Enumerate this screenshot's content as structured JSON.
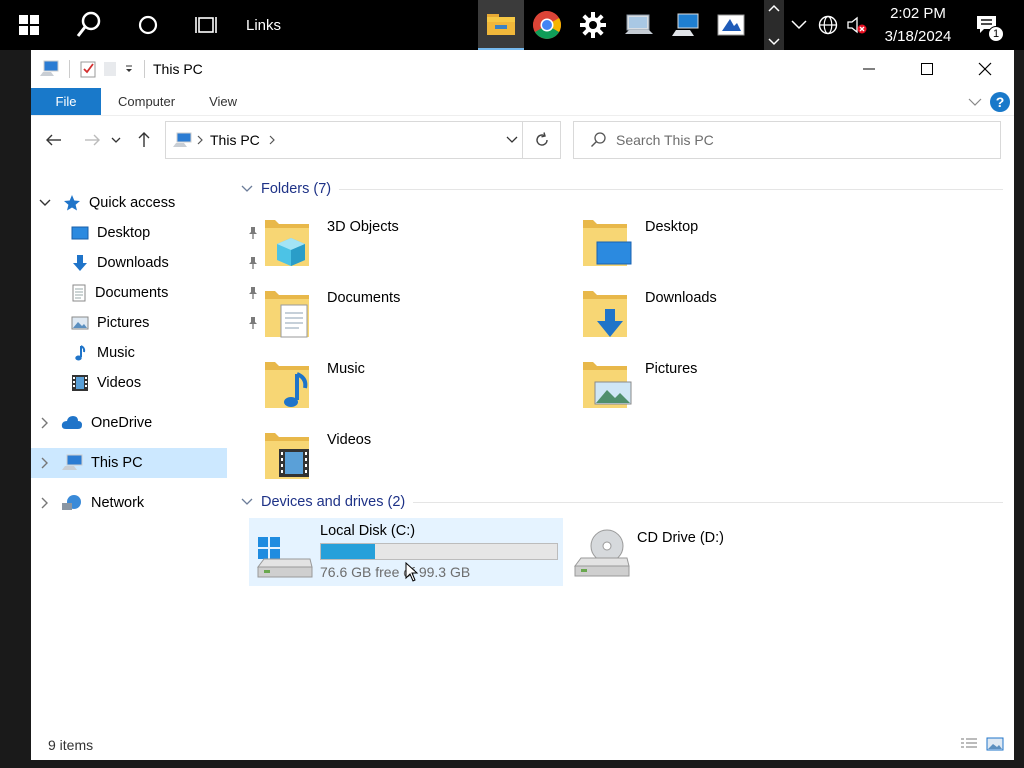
{
  "taskbar": {
    "links_label": "Links",
    "clock_time": "2:02 PM",
    "clock_date": "3/18/2024",
    "notification_count": "1",
    "icons": [
      "windows-start-icon",
      "search-icon",
      "cortana-icon",
      "task-view-icon",
      "file-explorer-icon",
      "chrome-icon",
      "settings-icon",
      "remote-desktop-icon",
      "network-computer-icon",
      "paint-icon",
      "chevron-up-icon",
      "chevron-down-icon",
      "tray-overflow-icon",
      "globe-icon",
      "volume-muted-icon",
      "action-center-icon"
    ]
  },
  "window": {
    "title": "This PC",
    "ribbon_tabs": [
      "File",
      "Computer",
      "View"
    ],
    "help_label": "?"
  },
  "navbar": {
    "address": "This PC",
    "search_placeholder": "Search This PC"
  },
  "sidebar": {
    "quick_access": "Quick access",
    "items": [
      "Desktop",
      "Downloads",
      "Documents",
      "Pictures",
      "Music",
      "Videos"
    ],
    "onedrive": "OneDrive",
    "this_pc": "This PC",
    "network": "Network"
  },
  "folders": {
    "header": "Folders (7)",
    "items": [
      "3D Objects",
      "Desktop",
      "Documents",
      "Downloads",
      "Music",
      "Pictures",
      "Videos"
    ]
  },
  "drives": {
    "header": "Devices and drives (2)",
    "items": [
      {
        "name": "Local Disk (C:)",
        "free": "76.6 GB free of 99.3 GB",
        "used_fraction": 0.229
      },
      {
        "name": "CD Drive (D:)"
      }
    ]
  },
  "status": {
    "items_count": "9 items"
  },
  "colors": {
    "accent": "#1979ca",
    "selection": "#cce8ff",
    "drive_fill": "#26a0da",
    "folder": "#f6d46b"
  }
}
